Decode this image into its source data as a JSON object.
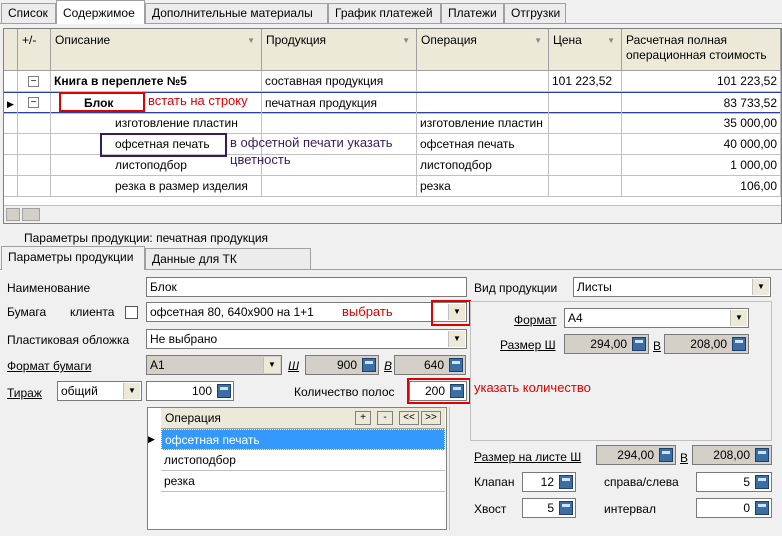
{
  "tabs": [
    "Список",
    "Содержимое",
    "Дополнительные материалы",
    "График платежей",
    "Платежи",
    "Отгрузки"
  ],
  "grid": {
    "headers": {
      "plusminus": "+/-",
      "description": "Описание",
      "product": "Продукция",
      "operation": "Операция",
      "price": "Цена",
      "cost_line1": "Расчетная полная",
      "cost_line2": "операционная стоимость"
    },
    "rows": [
      {
        "description": "Книга в переплете №5",
        "product": "составная продукция",
        "operation": "",
        "price": "101 223,52",
        "cost": "101 223,52"
      },
      {
        "description": "Блок",
        "product": "печатная продукция",
        "operation": "",
        "price": "",
        "cost": "83 733,52"
      },
      {
        "description": "изготовление пластин",
        "product": "",
        "operation": "изготовление пластин",
        "price": "",
        "cost": "35 000,00"
      },
      {
        "description": "офсетная печать",
        "product": "",
        "operation": "офсетная печать",
        "price": "",
        "cost": "40 000,00"
      },
      {
        "description": "листоподбор",
        "product": "",
        "operation": "листоподбор",
        "price": "",
        "cost": "1 000,00"
      },
      {
        "description": "резка в размер изделия",
        "product": "",
        "operation": "резка",
        "price": "",
        "cost": "106,00"
      }
    ]
  },
  "annotations": {
    "row_note": "встать на строку",
    "color_note_line1": "в офсетной печати указать",
    "color_note_line2": "цветность",
    "select_note": "выбрать",
    "count_note": "указать количество"
  },
  "params_caption": "Параметры продукции: печатная продукция",
  "subtabs": [
    "Параметры продукции",
    "Данные для ТК"
  ],
  "form": {
    "name_label": "Наименование",
    "name_value": "Блок",
    "paper_label": "Бумага",
    "client_label": "клиента",
    "paper_value": "офсетная 80, 640х900 на 1+1",
    "cover_label": "Пластиковая обложка",
    "cover_value": "Не выбрано",
    "paper_format_label": "Формат бумаги",
    "paper_format_value": "А1",
    "w_label": "Ш",
    "w_value": "900",
    "h_label": "В",
    "h_value": "640",
    "run_label": "Тираж",
    "run_type": "общий",
    "run_value": "100",
    "pages_label": "Количество полос",
    "pages_value": "200",
    "product_type_label": "Вид продукции",
    "product_type_value": "Листы",
    "format_label": "Формат",
    "format_value": "А4",
    "size_w_label": "Размер Ш",
    "size_w_value": "294,00",
    "size_h_label": "В",
    "size_h_value": "208,00",
    "sheet_size_label": "Размер на листе Ш",
    "sheet_w_value": "294,00",
    "sheet_h_label": "В",
    "sheet_h_value": "208,00",
    "flap_label": "Клапан",
    "flap_value": "12",
    "tail_label": "Хвост",
    "tail_value": "5",
    "rl_label": "справа/слева",
    "rl_value": "5",
    "interval_label": "интервал",
    "interval_value": "0"
  },
  "operations": {
    "header": "Операция",
    "buttons": [
      "+",
      "-",
      "<<",
      ">>"
    ],
    "items": [
      "офсетная печать",
      "листоподбор",
      "резка"
    ]
  }
}
